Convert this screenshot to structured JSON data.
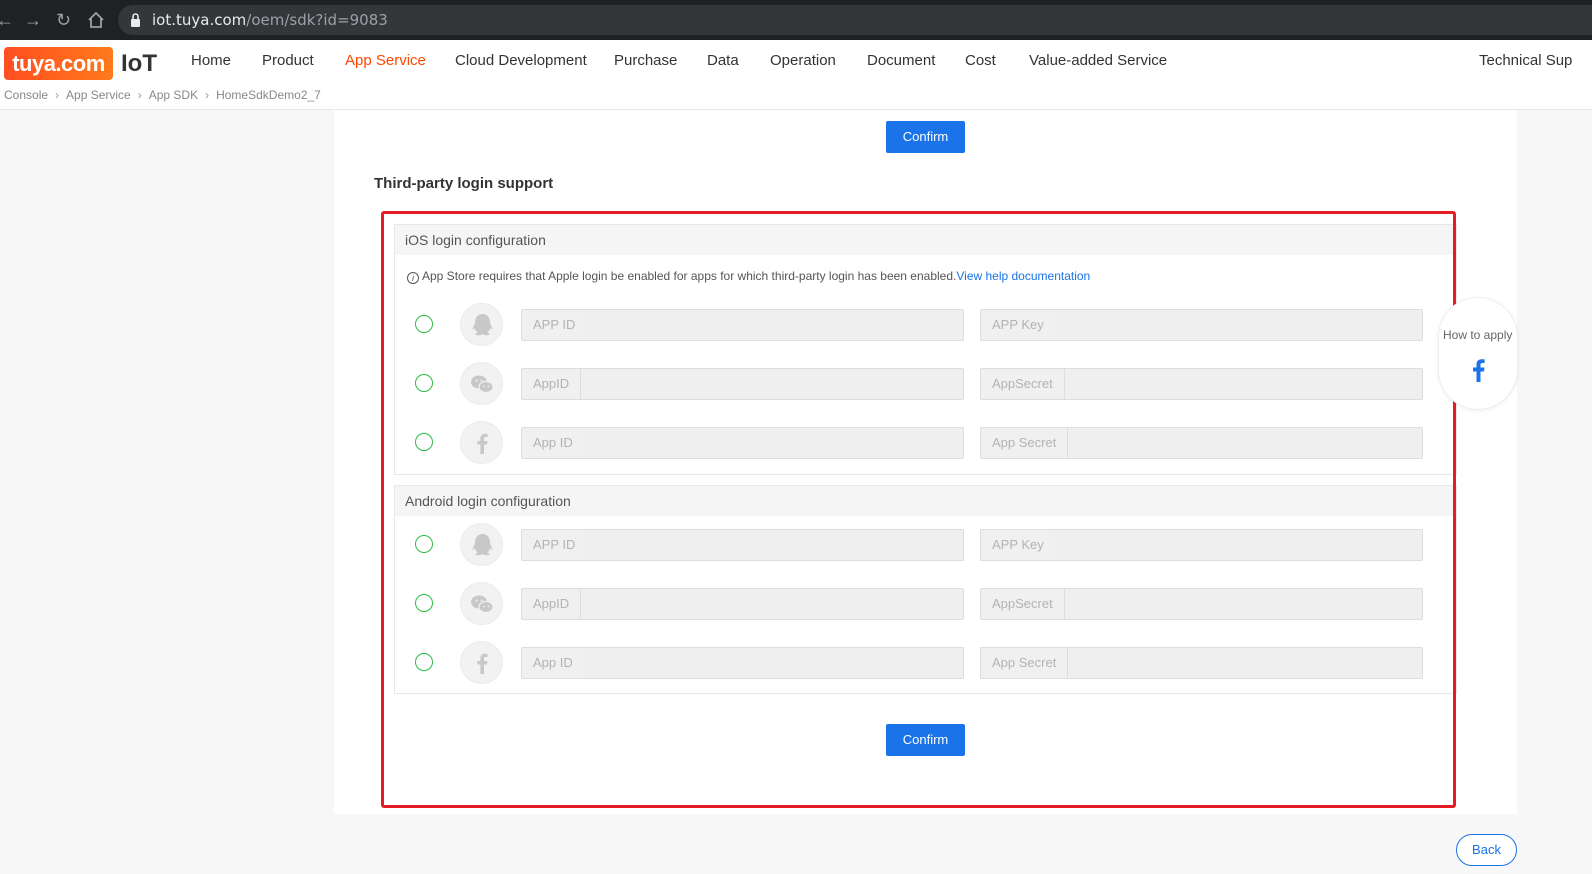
{
  "browser": {
    "url_domain": "iot.tuya.com",
    "url_path": "/oem/sdk?id=9083"
  },
  "header": {
    "logo_badge": "tuya.com",
    "logo_text": "IoT",
    "nav": [
      "Home",
      "Product",
      "App Service",
      "Cloud Development",
      "Purchase",
      "Data",
      "Operation",
      "Document",
      "Cost",
      "Value-added Service",
      "Technical Sup"
    ],
    "active_nav": "App Service",
    "accent_color": "#ff4800"
  },
  "breadcrumb": [
    "Console",
    "App Service",
    "App SDK",
    "HomeSdkDemo2_7"
  ],
  "top_confirm_label": "Confirm",
  "section_title": "Third-party login support",
  "ios": {
    "title": "iOS login configuration",
    "notice": "App Store requires that Apple login be enabled for apps for which third-party login has been enabled.",
    "notice_link": "View help documentation",
    "rows": [
      {
        "icon": "qq-icon",
        "left_label": "APP ID",
        "right_label": "APP Key"
      },
      {
        "icon": "wechat-icon",
        "left_label": "AppID",
        "right_label": "AppSecret"
      },
      {
        "icon": "facebook-icon",
        "left_label": "App ID",
        "right_label": "App Secret"
      }
    ]
  },
  "android": {
    "title": "Android login configuration",
    "rows": [
      {
        "icon": "qq-icon",
        "left_label": "APP ID",
        "right_label": "APP Key"
      },
      {
        "icon": "wechat-icon",
        "left_label": "AppID",
        "right_label": "AppSecret"
      },
      {
        "icon": "facebook-icon",
        "left_label": "App ID",
        "right_label": "App Secret"
      }
    ]
  },
  "bottom_confirm_label": "Confirm",
  "side_help": {
    "label": "How to apply",
    "icon": "facebook-icon"
  },
  "back_label": "Back",
  "colors": {
    "primary": "#1a73e8",
    "highlight": "#e51c23",
    "radio": "#2dbb44"
  }
}
